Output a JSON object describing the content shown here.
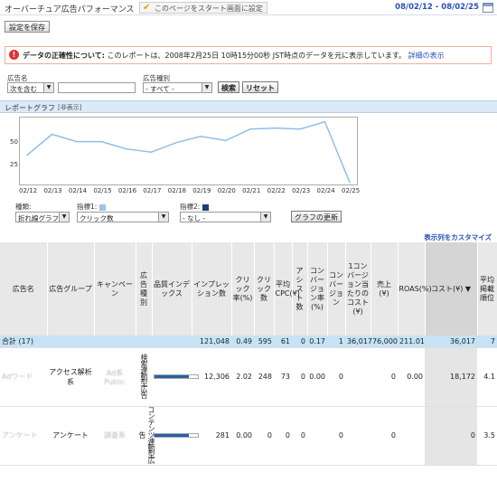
{
  "header": {
    "title": "オーバーチュア広告パフォーマンス",
    "set_start_label": "このページをスタート画面に設定",
    "date_range": "08/02/12 - 08/02/25",
    "save_label": "設定を保存"
  },
  "notice": {
    "heading": "データの正確性について:",
    "text": "このレポートは、2008年2月25日 10時15分00秒 JST時点のデータを元に表示しています。",
    "link": "詳細の表示"
  },
  "filters": {
    "ad_name_label": "広告名",
    "match_value": "次を含む",
    "ad_type_label": "広告種別",
    "ad_type_value": "- すべて -",
    "search_label": "検索",
    "reset_label": "リセット"
  },
  "graph": {
    "title": "レポートグラフ",
    "hide_label": "[非表示]",
    "type_label": "種類:",
    "type_value": "折れ線グラフ",
    "metric1_label": "指標1:",
    "metric1_value": "クリック数",
    "metric2_label": "指標2:",
    "metric2_value": "- なし -",
    "update_label": "グラフの更新",
    "colors": {
      "metric1": "#9cc3e6",
      "metric2": "#1f3d73",
      "line": "#8fbfe6"
    }
  },
  "chart_data": {
    "type": "line",
    "x": [
      "02/12",
      "02/13",
      "02/14",
      "02/15",
      "02/16",
      "02/17",
      "02/18",
      "02/19",
      "02/20",
      "02/21",
      "02/22",
      "02/23",
      "02/24",
      "02/25"
    ],
    "series": [
      {
        "name": "クリック数",
        "values": [
          28,
          48,
          41,
          41,
          34,
          31,
          40,
          46,
          42,
          53,
          54,
          53,
          60,
          2
        ]
      }
    ],
    "yticks": [
      "50",
      "25"
    ],
    "ylim": [
      0,
      64
    ]
  },
  "customize_label": "表示列をカスタマイズ",
  "table": {
    "headers": [
      "広告名",
      "広告グループ",
      "キャンペーン",
      "広告種別",
      "品質インデックス",
      "インプレッション数",
      "クリック率(%)",
      "クリック数",
      "平均CPC(¥)",
      "アシスト数",
      "コンバージョン率(%)",
      "コンバージョン",
      "1コンバージョン当たりのコスト(¥)",
      "売上(¥)",
      "ROAS(%)",
      "コスト(¥) ▼",
      "平均掲載順位"
    ],
    "total": [
      "合計 (17)",
      "",
      "",
      "",
      "",
      "121,048",
      "0.49",
      "595",
      "61",
      "0",
      "0.17",
      "1",
      "36,017",
      "76,000",
      "211.01",
      "36,017",
      "7"
    ],
    "rows": [
      {
        "ad_name": "Adワード",
        "group": "アクセス解析系",
        "campaign": "Ad系 Public",
        "type": "検索連動型広告",
        "quality": 0.8,
        "impressions": "12,306",
        "ctr": "2.02",
        "clicks": "248",
        "cpc": "73",
        "assists": "0",
        "cvr": "0.00",
        "conversions": "0",
        "cpa": "",
        "sales": "0",
        "roas": "0.00",
        "cost": "18,172",
        "position": "4.1"
      },
      {
        "ad_name": "アンケート",
        "group": "アンケート",
        "campaign": "調査系",
        "type": "コンテンツ連動型広告",
        "quality": 0.8,
        "impressions": "281",
        "ctr": "0.00",
        "clicks": "0",
        "cpc": "0",
        "assists": "0",
        "cvr": "",
        "conversions": "0",
        "cpa": "",
        "sales": "0",
        "roas": "",
        "cost": "0",
        "position": "3.5"
      }
    ]
  }
}
